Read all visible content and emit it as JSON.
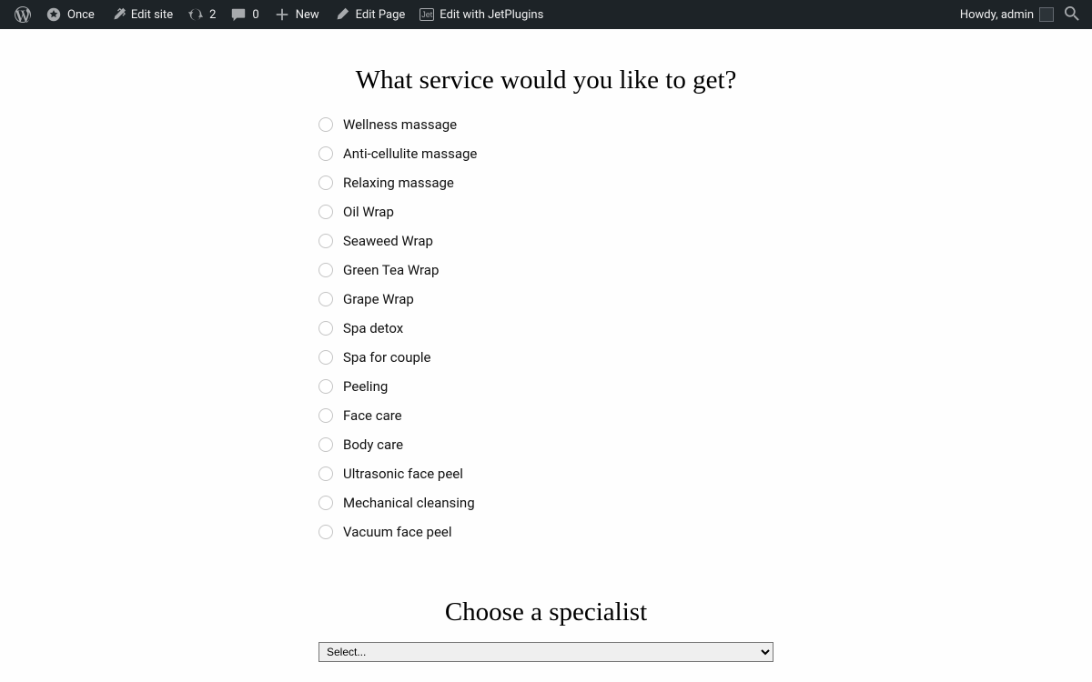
{
  "adminbar": {
    "site_name": "Once",
    "edit_site": "Edit site",
    "updates_count": "2",
    "comments_count": "0",
    "new": "New",
    "edit_page": "Edit Page",
    "jet": "Edit with JetPlugins",
    "howdy": "Howdy, admin"
  },
  "form": {
    "service_heading": "What service would you like to get?",
    "services": [
      "Wellness massage",
      "Anti-cellulite massage",
      "Relaxing massage",
      "Oil Wrap",
      "Seaweed Wrap",
      "Green Tea Wrap",
      "Grape Wrap",
      "Spa detox",
      "Spa for couple",
      "Peeling",
      "Face care",
      "Body care",
      "Ultrasonic face peel",
      "Mechanical cleansing",
      "Vacuum face peel"
    ],
    "specialist_heading": "Choose a specialist",
    "specialist_placeholder": "Select..."
  }
}
